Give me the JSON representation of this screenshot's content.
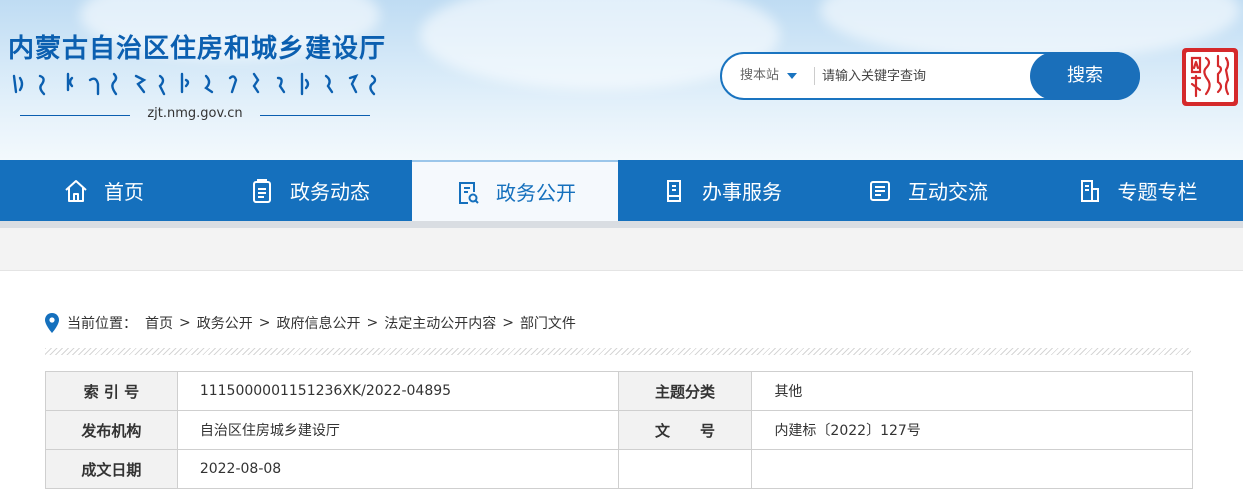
{
  "header": {
    "site_title": "内蒙古自治区住房和城乡建设厅",
    "domain": "zjt.nmg.gov.cn",
    "seal_logo": "inner-mongolia-seal"
  },
  "search": {
    "scope_label": "搜本站",
    "placeholder": "请输入关键字查询",
    "button_label": "搜索"
  },
  "nav": {
    "items": [
      {
        "label": "首页",
        "icon": "home-icon"
      },
      {
        "label": "政务动态",
        "icon": "clipboard-icon"
      },
      {
        "label": "政务公开",
        "icon": "document-search-icon",
        "active": true
      },
      {
        "label": "办事服务",
        "icon": "service-doc-icon"
      },
      {
        "label": "互动交流",
        "icon": "interaction-icon"
      },
      {
        "label": "专题专栏",
        "icon": "column-doc-icon"
      }
    ]
  },
  "breadcrumb": {
    "prefix": "当前位置：",
    "sep": ">",
    "items": [
      "首页",
      "政务公开",
      "政府信息公开",
      "法定主动公开内容",
      "部门文件"
    ]
  },
  "meta_table": {
    "rows": [
      {
        "k1": "索 引 号",
        "v1": "111500000115123 6XK/2022-04895",
        "k2": "主题分类",
        "v2": "其他"
      },
      {
        "k1": "发布机构",
        "v1": "自治区住房城乡建设厅",
        "k2": "文　　号",
        "v2": "内建标〔2022〕127号"
      },
      {
        "k1": "成文日期",
        "v1": "2022-08-08",
        "k2": "",
        "v2": ""
      }
    ]
  },
  "colors": {
    "primary": "#1570bd",
    "title": "#0b5fb0",
    "seal_red": "#d5292b"
  }
}
